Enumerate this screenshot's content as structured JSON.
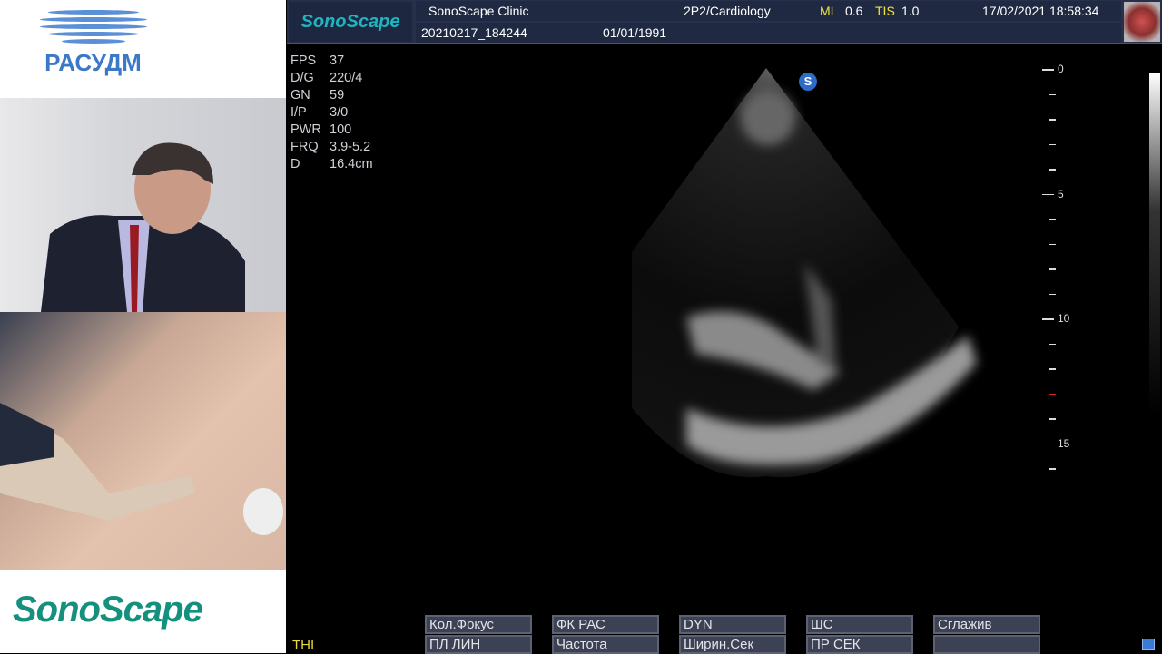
{
  "left_panel": {
    "org_logo": "РАСУДМ",
    "brand_logo": "SonoScape"
  },
  "header": {
    "logo": "SonoScape",
    "clinic": "SonoScape Clinic",
    "probe_preset": "2P2/Cardiology",
    "mi_label": "MI",
    "mi_value": "0.6",
    "tis_label": "TIS",
    "tis_value": "1.0",
    "datetime": "17/02/2021 18:58:34",
    "patient_id": "20210217_184244",
    "birth_date": "01/01/1991",
    "preset_icon": "heart-icon"
  },
  "params": [
    {
      "k": "FPS",
      "v": "37"
    },
    {
      "k": "D/G",
      "v": "220/4"
    },
    {
      "k": "GN",
      "v": "59"
    },
    {
      "k": "I/P",
      "v": "3/0"
    },
    {
      "k": "PWR",
      "v": "100"
    },
    {
      "k": "FRQ",
      "v": "3.9-5.2"
    },
    {
      "k": "D",
      "v": "16.4cm"
    }
  ],
  "depth_scale": {
    "labels": [
      "0",
      "5",
      "10",
      "15"
    ],
    "max_cm": 16,
    "focus_cm": 13,
    "focus_color": "#e02020"
  },
  "softkeys": [
    {
      "top": "Кол.Фокус",
      "bottom": "ПЛ ЛИН"
    },
    {
      "top": "ФК РАС",
      "bottom": "Частота"
    },
    {
      "top": "DYN",
      "bottom": "Ширин.Сек"
    },
    {
      "top": "ШС",
      "bottom": "ПР СЕК"
    },
    {
      "top": "Сглажив",
      "bottom": ""
    }
  ],
  "mode_label": "THI",
  "orientation_marker": "S"
}
